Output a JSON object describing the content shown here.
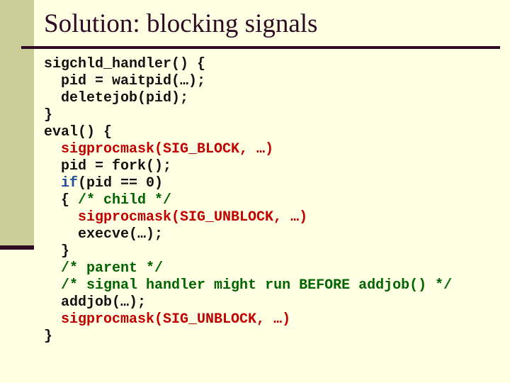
{
  "slide": {
    "title": "Solution: blocking signals",
    "colors": {
      "background": "#FFFFE3",
      "side_band": "#CCCC99",
      "rule": "#2E0A24",
      "code_plain": "#111111",
      "code_call": "#C00000",
      "code_comment": "#006400",
      "code_keyword": "#1F4E9C"
    },
    "code_lines": [
      {
        "indent": "",
        "segments": [
          {
            "type": "plain",
            "text": "sigchld_handler() {"
          }
        ]
      },
      {
        "indent": "  ",
        "segments": [
          {
            "type": "plain",
            "text": "pid = waitpid(…);"
          }
        ]
      },
      {
        "indent": "  ",
        "segments": [
          {
            "type": "plain",
            "text": "deletejob(pid);"
          }
        ]
      },
      {
        "indent": "",
        "segments": [
          {
            "type": "plain",
            "text": "}"
          }
        ]
      },
      {
        "indent": "",
        "segments": [
          {
            "type": "plain",
            "text": "eval() {"
          }
        ]
      },
      {
        "indent": "  ",
        "segments": [
          {
            "type": "call",
            "text": "sigprocmask(SIG_BLOCK, …)"
          }
        ]
      },
      {
        "indent": "  ",
        "segments": [
          {
            "type": "plain",
            "text": "pid = fork();"
          }
        ]
      },
      {
        "indent": "  ",
        "segments": [
          {
            "type": "keyword",
            "text": "if"
          },
          {
            "type": "plain",
            "text": "(pid == 0)"
          }
        ]
      },
      {
        "indent": "  ",
        "segments": [
          {
            "type": "plain",
            "text": "{ "
          },
          {
            "type": "comment",
            "text": "/* child */"
          }
        ]
      },
      {
        "indent": "    ",
        "segments": [
          {
            "type": "call",
            "text": "sigprocmask(SIG_UNBLOCK, …)"
          }
        ]
      },
      {
        "indent": "    ",
        "segments": [
          {
            "type": "plain",
            "text": "execve(…);"
          }
        ]
      },
      {
        "indent": "  ",
        "segments": [
          {
            "type": "plain",
            "text": "}"
          }
        ]
      },
      {
        "indent": "  ",
        "segments": [
          {
            "type": "comment",
            "text": "/* parent */"
          }
        ]
      },
      {
        "indent": "  ",
        "segments": [
          {
            "type": "comment",
            "text": "/* signal handler might run BEFORE addjob() */"
          }
        ]
      },
      {
        "indent": "  ",
        "segments": [
          {
            "type": "plain",
            "text": "addjob(…);"
          }
        ]
      },
      {
        "indent": "  ",
        "segments": [
          {
            "type": "call",
            "text": "sigprocmask(SIG_UNBLOCK, …)"
          }
        ]
      },
      {
        "indent": "",
        "segments": [
          {
            "type": "plain",
            "text": "}"
          }
        ]
      }
    ]
  }
}
